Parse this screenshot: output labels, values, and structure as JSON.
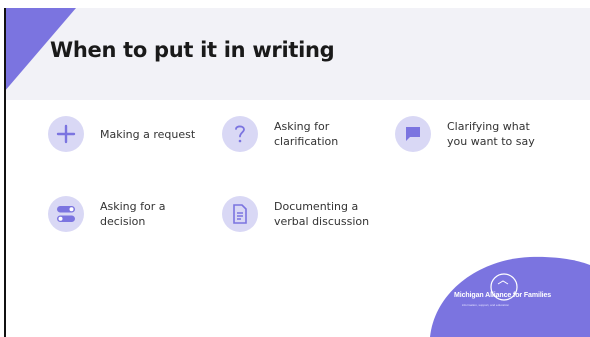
{
  "slide": {
    "title": "When to put it in writing",
    "items": [
      {
        "icon": "plus-icon",
        "label_line1": "Making a request",
        "label_line2": ""
      },
      {
        "icon": "question-icon",
        "label_line1": "Asking for",
        "label_line2": "clarification"
      },
      {
        "icon": "speech-bubble-icon",
        "label_line1": "Clarifying what",
        "label_line2": "you want to say"
      },
      {
        "icon": "toggle-icon",
        "label_line1": "Asking for a",
        "label_line2": "decision"
      },
      {
        "icon": "document-icon",
        "label_line1": "Documenting a",
        "label_line2": "verbal discussion"
      }
    ],
    "logo_text": "Michigan Alliance for Families",
    "logo_tagline": "information, support, and education",
    "colors": {
      "accent": "#7b74e0",
      "icon_bg": "#d9d8f5",
      "header_bg": "#f2f2f7"
    }
  }
}
